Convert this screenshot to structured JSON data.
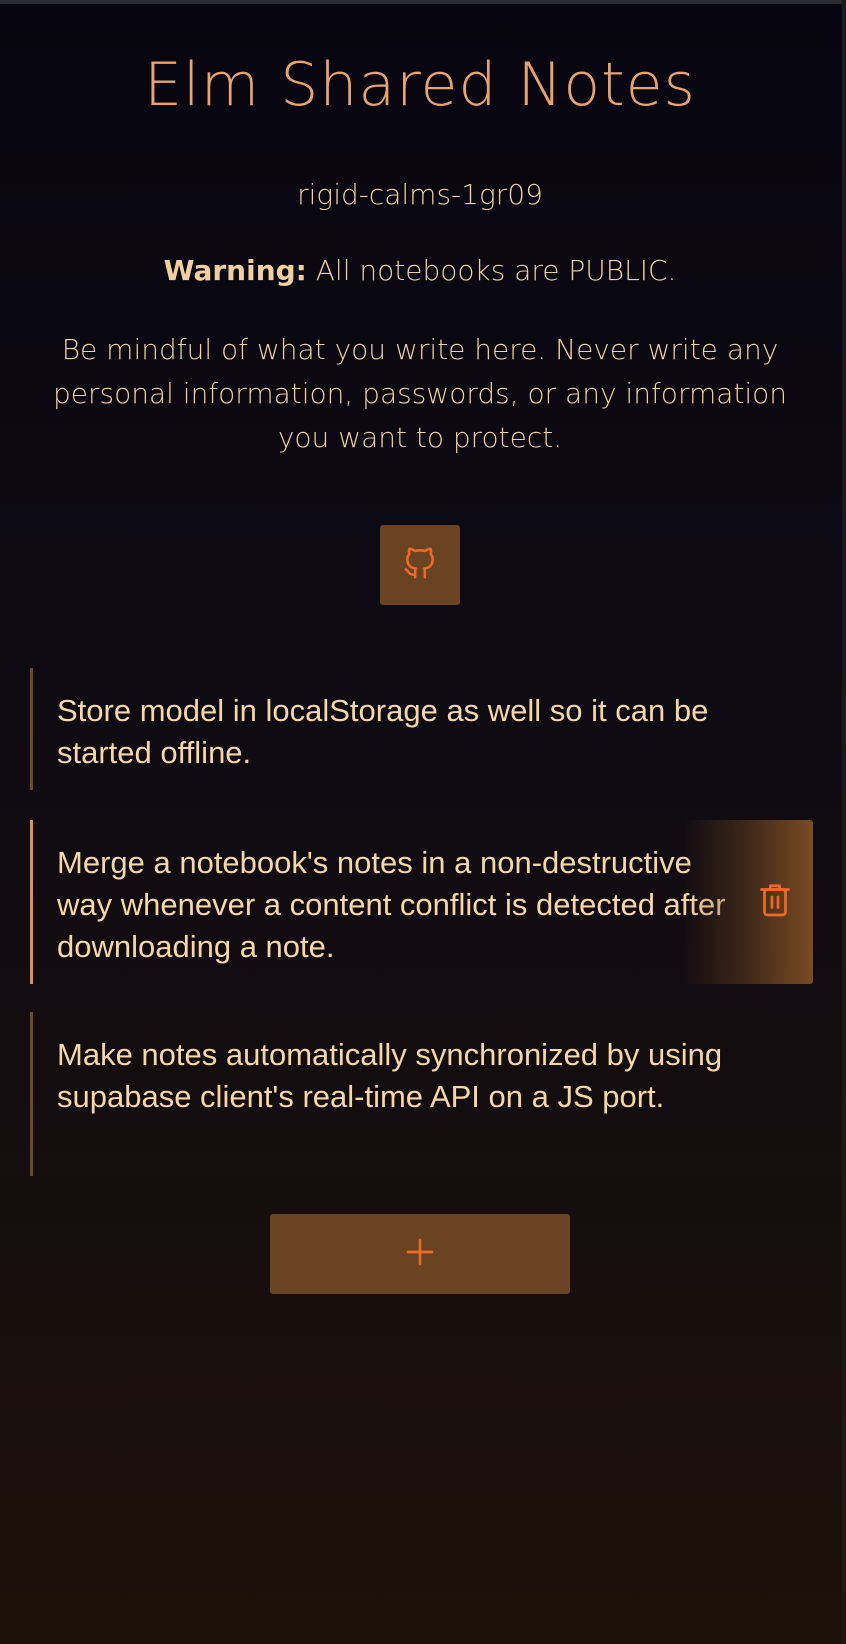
{
  "app": {
    "title": "Elm Shared Notes",
    "notebook_id": "rigid-calms-1gr09",
    "warning_label": "Warning:",
    "warning_text": " All notebooks are PUBLIC.",
    "advice": "Be mindful of what you write here. Never write any personal information, passwords, or any information you want to protect."
  },
  "icons": {
    "github": "github-icon",
    "delete": "trash-icon",
    "add": "plus-icon"
  },
  "colors": {
    "accent": "#e9a36b",
    "icon": "#ee6a2c",
    "button_bg": "#6a4422",
    "text": "#f0d0a0"
  },
  "notes": [
    {
      "text": "Store model in localStorage as well so it can be started offline."
    },
    {
      "text": "Merge a notebook's notes in a non-destructive way whenever a content conflict is detected after downloading a note."
    },
    {
      "text": "Make notes automatically synchronized by using supabase client's real-time API on a JS port."
    }
  ]
}
